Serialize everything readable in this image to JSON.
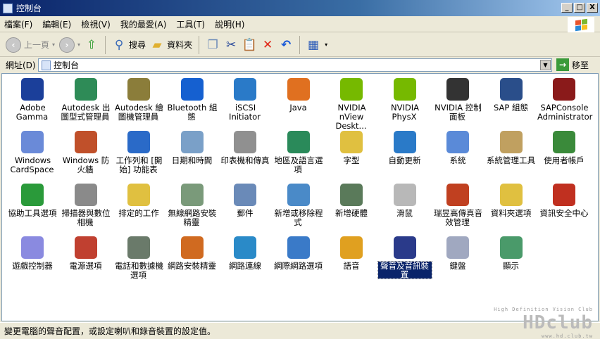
{
  "window": {
    "title": "控制台"
  },
  "menu": [
    "檔案(F)",
    "編輯(E)",
    "檢視(V)",
    "我的最愛(A)",
    "工具(T)",
    "說明(H)"
  ],
  "toolbar": {
    "back": "上一頁",
    "search": "搜尋",
    "folders": "資料夾"
  },
  "address": {
    "label": "網址(D)",
    "value": "控制台",
    "go": "移至"
  },
  "items": [
    {
      "label": "Adobe Gamma",
      "icon": "monitor-icon",
      "color": "#1b3f9a"
    },
    {
      "label": "Autodesk 出圖型式管理員",
      "icon": "plot-style-icon",
      "color": "#2e8b57"
    },
    {
      "label": "Autodesk 繪圖機管理員",
      "icon": "plotter-icon",
      "color": "#8b7d3a"
    },
    {
      "label": "Bluetooth 組態",
      "icon": "bluetooth-icon",
      "color": "#1560d0"
    },
    {
      "label": "iSCSI Initiator",
      "icon": "globe-icon",
      "color": "#2a7ac8"
    },
    {
      "label": "Java",
      "icon": "java-icon",
      "color": "#e07020"
    },
    {
      "label": "NVIDIA nView Deskt...",
      "icon": "nvidia-icon",
      "color": "#76b900"
    },
    {
      "label": "NVIDIA PhysX",
      "icon": "nvidia-icon",
      "color": "#76b900"
    },
    {
      "label": "NVIDIA 控制面板",
      "icon": "nvidia-panel-icon",
      "color": "#333333"
    },
    {
      "label": "SAP 組態",
      "icon": "sap-icon",
      "color": "#2a4e8a"
    },
    {
      "label": "SAPConsole Administrator",
      "icon": "console-icon",
      "color": "#8a1a1a"
    },
    {
      "label": "Windows CardSpace",
      "icon": "cardspace-icon",
      "color": "#6a8ad8"
    },
    {
      "label": "Windows 防火牆",
      "icon": "firewall-icon",
      "color": "#c0502a"
    },
    {
      "label": "工作列和 [開始] 功能表",
      "icon": "taskbar-icon",
      "color": "#2a6ac8"
    },
    {
      "label": "日期和時間",
      "icon": "clock-icon",
      "color": "#7aa0c8"
    },
    {
      "label": "印表機和傳真",
      "icon": "printer-icon",
      "color": "#909090"
    },
    {
      "label": "地區及語言選項",
      "icon": "globe-icon",
      "color": "#2a8a5a"
    },
    {
      "label": "字型",
      "icon": "fonts-folder-icon",
      "color": "#e0c040"
    },
    {
      "label": "自動更新",
      "icon": "windows-update-icon",
      "color": "#2a7ac8"
    },
    {
      "label": "系統",
      "icon": "system-icon",
      "color": "#5a8ad8"
    },
    {
      "label": "系統管理工具",
      "icon": "admin-tools-icon",
      "color": "#c0a060"
    },
    {
      "label": "使用者帳戶",
      "icon": "users-icon",
      "color": "#3a8a3a"
    },
    {
      "label": "協助工具選項",
      "icon": "accessibility-icon",
      "color": "#2a9a3a"
    },
    {
      "label": "掃描器與數位相機",
      "icon": "scanner-icon",
      "color": "#8a8a8a"
    },
    {
      "label": "排定的工作",
      "icon": "scheduled-tasks-icon",
      "color": "#e0c040"
    },
    {
      "label": "無線網路安裝精靈",
      "icon": "wireless-icon",
      "color": "#7a9a7a"
    },
    {
      "label": "郵件",
      "icon": "mail-icon",
      "color": "#6a8ab8"
    },
    {
      "label": "新增或移除程式",
      "icon": "add-remove-icon",
      "color": "#4a8ac8"
    },
    {
      "label": "新增硬體",
      "icon": "hardware-icon",
      "color": "#5a7a5a"
    },
    {
      "label": "滑鼠",
      "icon": "mouse-icon",
      "color": "#b8b8b8"
    },
    {
      "label": "瑞昱高傳真音效管理",
      "icon": "speaker-icon",
      "color": "#c04020"
    },
    {
      "label": "資料夾選項",
      "icon": "folder-options-icon",
      "color": "#e0c040"
    },
    {
      "label": "資訊安全中心",
      "icon": "shield-icon",
      "color": "#c03020"
    },
    {
      "label": "遊戲控制器",
      "icon": "gamepad-icon",
      "color": "#8a8ae0"
    },
    {
      "label": "電源選項",
      "icon": "power-icon",
      "color": "#c04030"
    },
    {
      "label": "電話和數據機選項",
      "icon": "phone-icon",
      "color": "#6a7a6a"
    },
    {
      "label": "網路安裝精靈",
      "icon": "network-home-icon",
      "color": "#d06a20"
    },
    {
      "label": "網路連線",
      "icon": "network-globe-icon",
      "color": "#2a8ac8"
    },
    {
      "label": "網際網路選項",
      "icon": "internet-options-icon",
      "color": "#3a7ac8"
    },
    {
      "label": "語音",
      "icon": "speech-icon",
      "color": "#e0a020"
    },
    {
      "label": "聲音及音訊裝置",
      "icon": "sound-icon",
      "color": "#2a3a8a",
      "selected": true
    },
    {
      "label": "鍵盤",
      "icon": "keyboard-icon",
      "color": "#a0a8c0"
    },
    {
      "label": "顯示",
      "icon": "display-icon",
      "color": "#4a9a6a"
    }
  ],
  "status": {
    "text": "變更電腦的聲音配置，或設定喇叭和錄音裝置的設定值。"
  },
  "watermark": {
    "brand": "HDclub",
    "tagline": "High Definition Vision Club",
    "url": "www.hd.club.tw"
  }
}
